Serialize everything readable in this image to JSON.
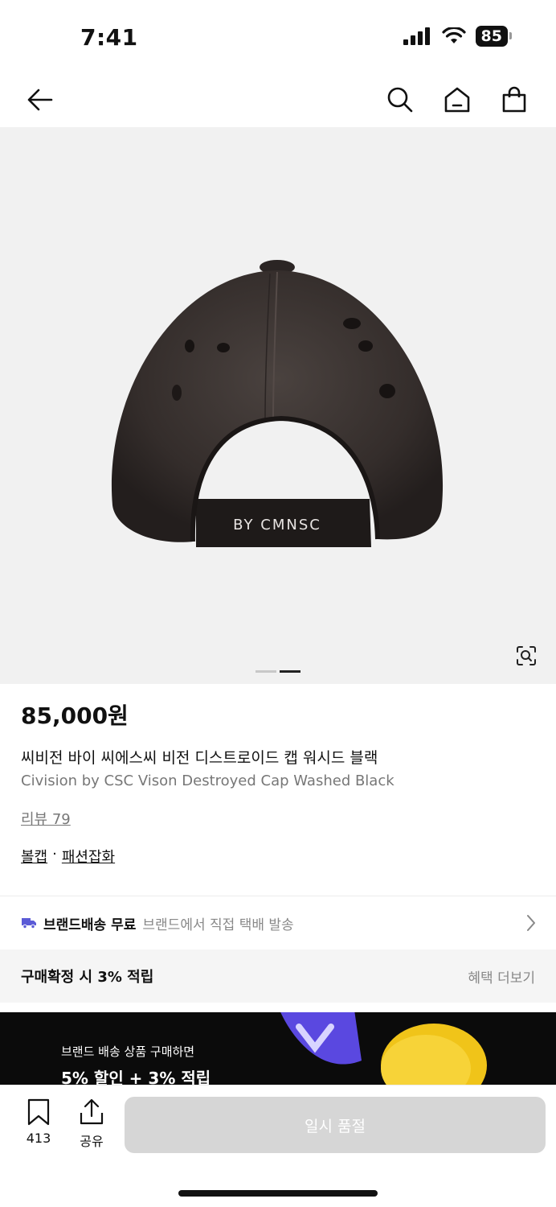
{
  "status": {
    "time": "7:41",
    "battery": "85"
  },
  "nav": {
    "back": "back-arrow-icon",
    "search": "search-icon",
    "home": "home-icon",
    "cart": "shopping-bag-icon"
  },
  "product": {
    "image_label": "BY CMNSC",
    "price": "85,000원",
    "name_ko": "씨비전 바이 씨에스씨 비전 디스트로이드 캡 워시드 블랙",
    "name_en": "Civision by CSC Vison Destroyed Cap Washed Black",
    "review": "리뷰 79",
    "categories": [
      "볼캡",
      "패션잡화"
    ],
    "category_separator": "·"
  },
  "delivery": {
    "bold": "브랜드배송 무료",
    "sub": "브랜드에서 직접 택배 발송"
  },
  "points": {
    "label": "구매확정 시 3% 적립",
    "more": "혜택 더보기"
  },
  "banner": {
    "line1": "브랜드 배송 상품 구매하면",
    "line2": "5% 할인 + 3% 적립"
  },
  "bottom": {
    "wish_count": "413",
    "share_label": "공유",
    "soldout_label": "일시 품절"
  },
  "colors": {
    "accent_icon": "#5b5bd6",
    "button_disabled": "#d6d6d6",
    "cap": "#3a3331"
  }
}
